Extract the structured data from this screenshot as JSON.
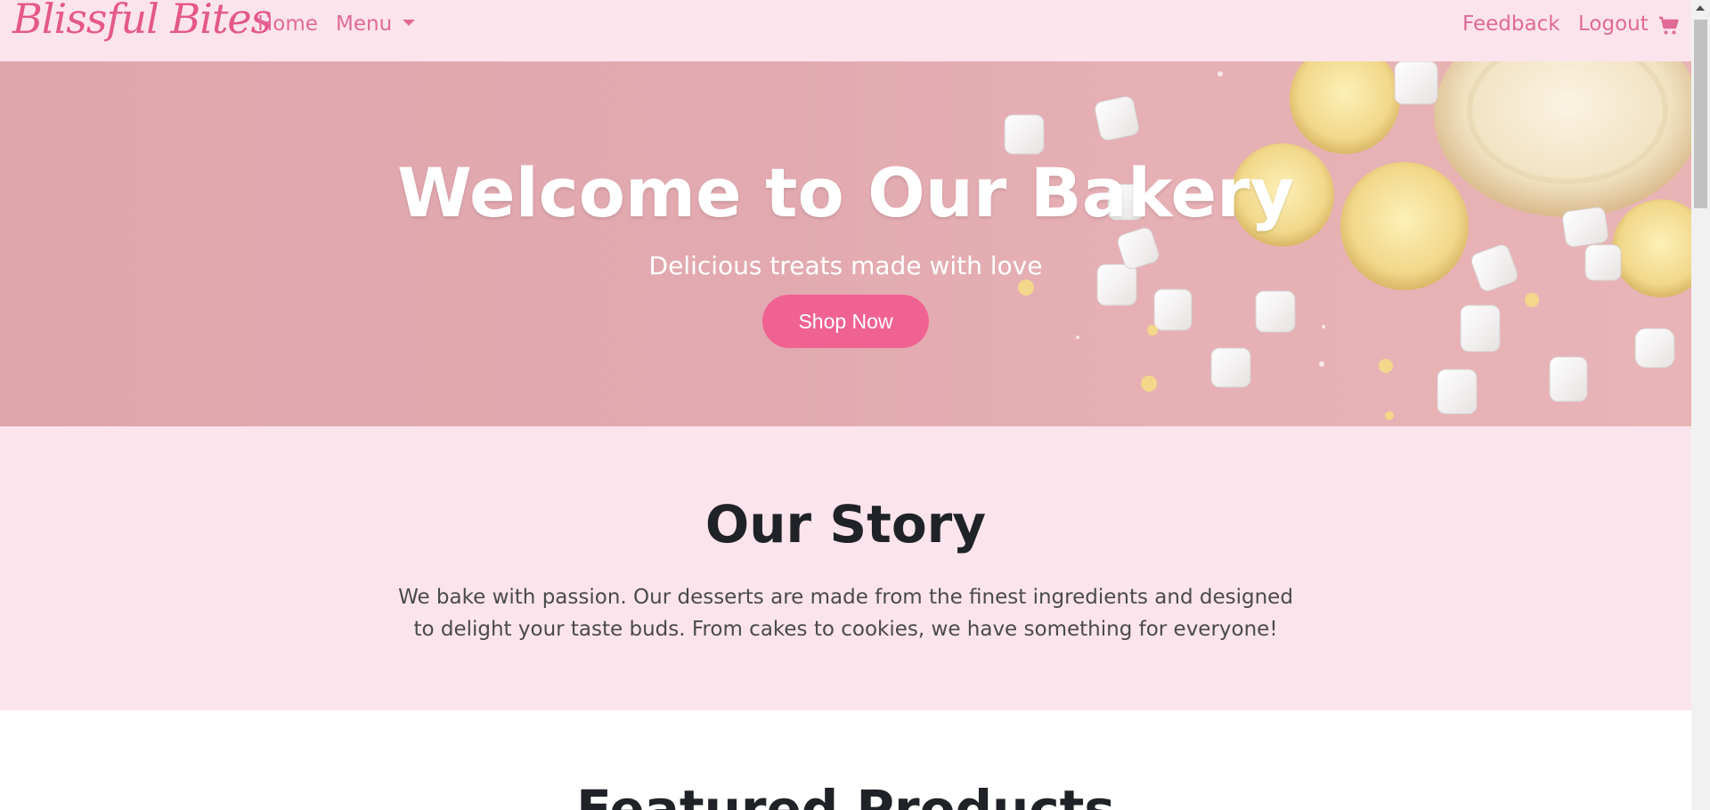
{
  "brand": {
    "name": "Blissful Bites",
    "color": "#e4588a"
  },
  "nav": {
    "home": "Home",
    "menu": "Menu",
    "feedback": "Feedback",
    "logout": "Logout",
    "cart_icon": "shopping-cart-icon",
    "link_color": "#e06a96"
  },
  "hero": {
    "title": "Welcome to Our Bakery",
    "subtitle": "Delicious treats made with love",
    "button": "Shop Now",
    "button_color": "#f06292"
  },
  "story": {
    "title": "Our Story",
    "text": "We bake with passion. Our desserts are made from the finest ingredients and designed to delight your taste buds. From cakes to cookies, we have something for everyone!",
    "background": "#fce4ec"
  },
  "featured": {
    "title": "Featured Products"
  }
}
